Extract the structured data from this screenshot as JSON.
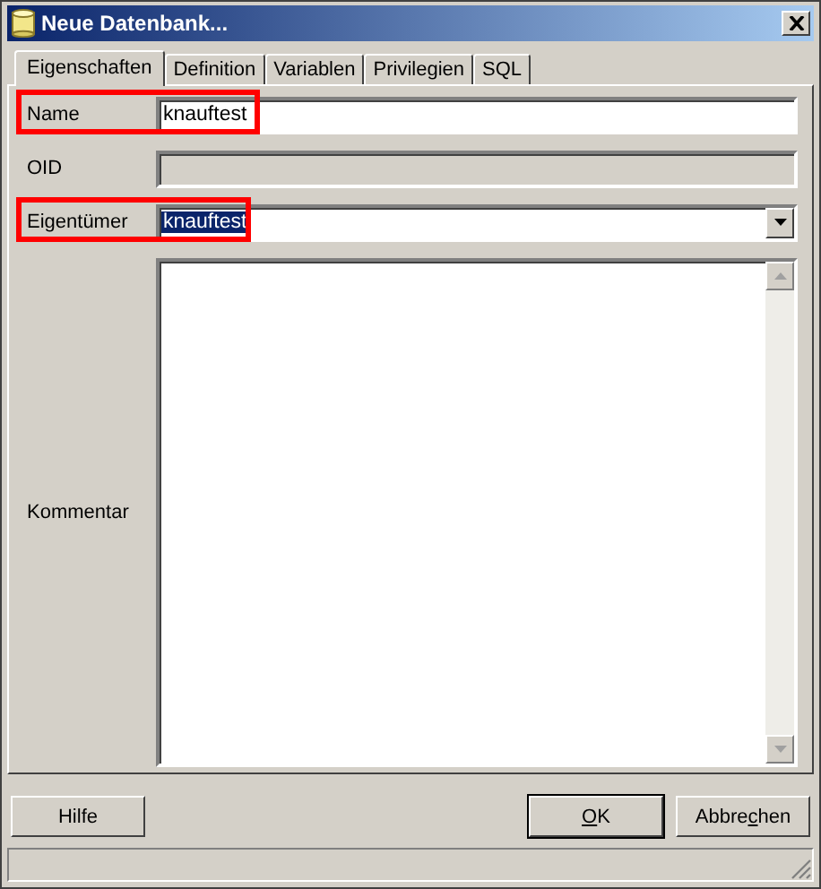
{
  "window": {
    "title": "Neue Datenbank..."
  },
  "tabs": [
    {
      "label": "Eigenschaften",
      "selected": true
    },
    {
      "label": "Definition",
      "selected": false
    },
    {
      "label": "Variablen",
      "selected": false
    },
    {
      "label": "Privilegien",
      "selected": false
    },
    {
      "label": "SQL",
      "selected": false
    }
  ],
  "fields": [
    {
      "kind": "text",
      "label": "Name",
      "value": "knauftest",
      "disabled": false,
      "highlighted": true
    },
    {
      "kind": "text",
      "label": "OID",
      "disabled": true,
      "highlighted": false
    },
    {
      "kind": "combo",
      "label": "Eigentümer",
      "value": "knauftest",
      "value_selected": true,
      "highlighted": true
    },
    {
      "kind": "textarea",
      "label": "Kommentar",
      "highlighted": false
    }
  ],
  "buttons": [
    {
      "pre": "Hilfe",
      "default": false
    },
    {
      "key": "O",
      "post": "K",
      "default": true
    },
    {
      "pre": "Abbre",
      "key": "c",
      "post": "hen",
      "default": false
    }
  ]
}
